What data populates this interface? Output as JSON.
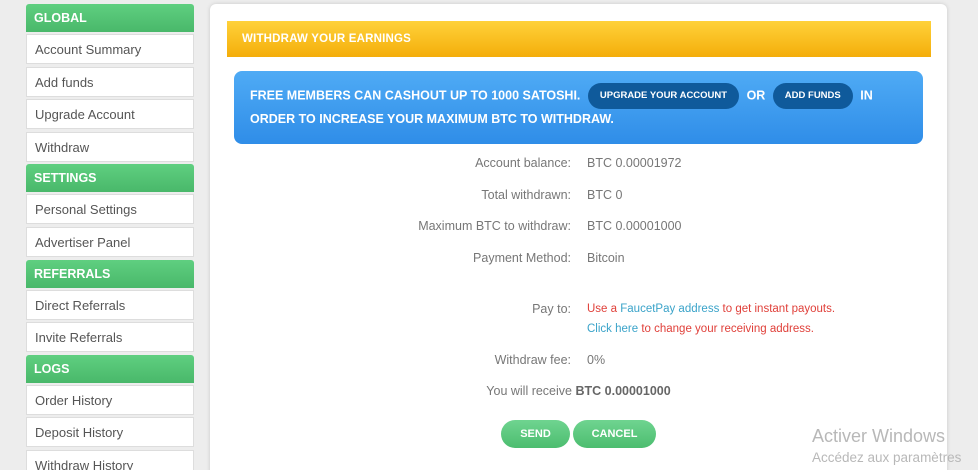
{
  "sidebar": {
    "global": {
      "header": "GLOBAL",
      "items": [
        "Account Summary",
        "Add funds",
        "Upgrade Account",
        "Withdraw"
      ]
    },
    "settings": {
      "header": "SETTINGS",
      "items": [
        "Personal Settings",
        "Advertiser Panel"
      ]
    },
    "referrals": {
      "header": "REFERRALS",
      "items": [
        "Direct Referrals",
        "Invite Referrals"
      ]
    },
    "logs": {
      "header": "LOGS",
      "items": [
        "Order History",
        "Deposit History",
        "Withdraw History"
      ]
    }
  },
  "main": {
    "title": "WITHDRAW YOUR EARNINGS",
    "notice": {
      "text1": "FREE MEMBERS CAN CASHOUT UP TO 1000 SATOSHI.",
      "upgrade_button": "UPGRADE YOUR ACCOUNT",
      "or": "OR",
      "add_funds_button": "ADD FUNDS",
      "text2": "IN",
      "text3": "ORDER TO INCREASE YOUR MAXIMUM BTC TO WITHDRAW."
    },
    "fields": {
      "balance_label": "Account balance:",
      "balance_value": "BTC 0.00001972",
      "withdrawn_label": "Total withdrawn:",
      "withdrawn_value": "BTC 0",
      "max_label": "Maximum BTC to withdraw:",
      "max_value": "BTC 0.00001000",
      "method_label": "Payment Method:",
      "method_value": "Bitcoin",
      "payto_label": "Pay to:",
      "payto_line1_a": "Use a ",
      "payto_line1_link": "FaucetPay address",
      "payto_line1_b": " to get instant payouts.",
      "payto_line2_link": "Click here",
      "payto_line2_b": " to change your receiving address.",
      "fee_label": "Withdraw fee:",
      "fee_value": "0%",
      "receive_text": "You will receive",
      "receive_value": "BTC 0.00001000"
    },
    "buttons": {
      "send": "SEND",
      "cancel": "CANCEL"
    }
  },
  "watermark": {
    "line1": "Activer Windows",
    "line2": "Accédez aux paramètres"
  }
}
